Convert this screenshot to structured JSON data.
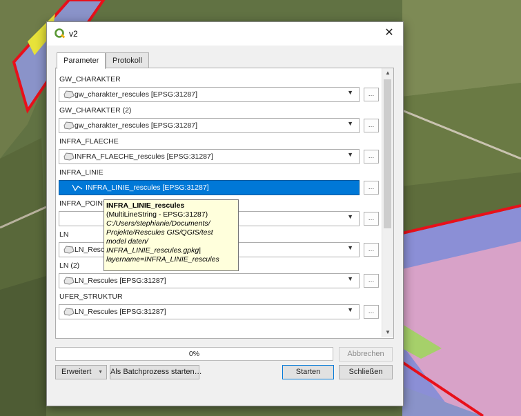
{
  "dialog": {
    "title": "v2",
    "close_glyph": "✕",
    "logo_icon": "qgis-logo-icon",
    "tabs": [
      {
        "label": "Parameter",
        "active": true
      },
      {
        "label": "Protokoll",
        "active": false
      }
    ]
  },
  "parameters": [
    {
      "label": "GW_CHARAKTER",
      "value": "gw_charakter_rescules [EPSG:31287]",
      "icon": "polygon-layer-icon"
    },
    {
      "label": "GW_CHARAKTER (2)",
      "value": "gw_charakter_rescules [EPSG:31287]",
      "icon": "polygon-layer-icon"
    },
    {
      "label": "INFRA_FLAECHE",
      "value": "INFRA_FLAECHE_rescules [EPSG:31287]",
      "icon": "polygon-layer-icon"
    },
    {
      "label": "INFRA_LINIE",
      "value": "INFRA_LINIE_rescules [EPSG:31287]",
      "icon": "line-layer-icon"
    },
    {
      "label": "INFRA_POINT",
      "value": "",
      "icon": ""
    },
    {
      "label": "LN",
      "value": "LN_Rescules [EPSG:31287]",
      "icon": "polygon-layer-icon"
    },
    {
      "label": "LN (2)",
      "value": "LN_Rescules [EPSG:31287]",
      "icon": "polygon-layer-icon"
    },
    {
      "label": "UFER_STRUKTUR",
      "value": "LN_Rescules [EPSG:31287]",
      "icon": "polygon-layer-icon"
    }
  ],
  "combo_arrow": "▼",
  "dots_button_label": "…",
  "tooltip": {
    "name": "INFRA_LINIE_rescules",
    "type": "(MultiLineString - EPSG:31287)",
    "path": "C:/Users/stephianie/Documents/\nProjekte/Rescules GIS/QGIS/test\nmodel daten/\nINFRA_LINIE_rescules.gpkg|\nlayername=INFRA_LINIE_rescules"
  },
  "progress": {
    "text": "0%",
    "value": 0
  },
  "buttons": {
    "cancel": "Abbrechen",
    "advanced": "Erweitert",
    "advanced_arrow": "▼",
    "batch": "Als Batchprozess starten…",
    "run": "Starten",
    "close": "Schließen"
  },
  "colors": {
    "selection": "#0078d7",
    "tooltip_bg": "#ffffdc",
    "map_red_outline": "#e8101a"
  }
}
